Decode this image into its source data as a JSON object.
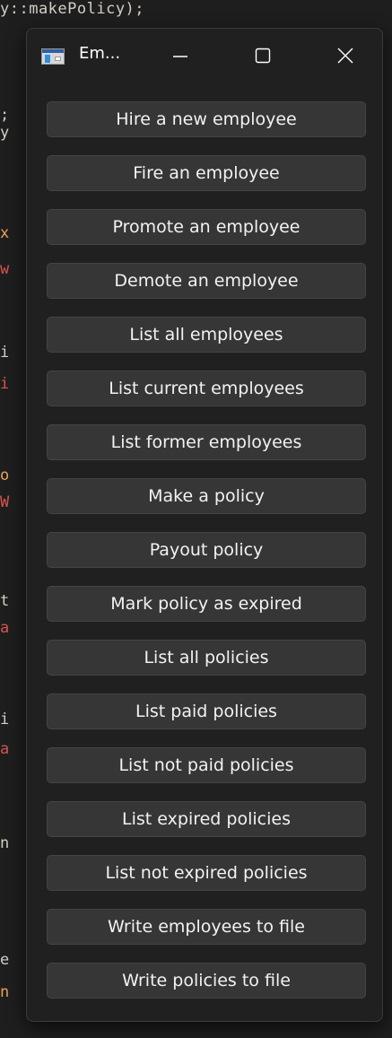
{
  "background_code": {
    "top_line": "y::makePolicy);",
    "fragments": [
      {
        "text": ";",
        "color": "#d4cfc4"
      },
      {
        "text": "y",
        "color": "#d4cfc4"
      },
      {
        "text": "x",
        "color": "#e8a35c"
      },
      {
        "text": "w",
        "color": "#d9534f"
      },
      {
        "text": "i",
        "color": "#d4cfc4"
      },
      {
        "text": "i",
        "color": "#d9534f"
      },
      {
        "text": "o",
        "color": "#e8a35c"
      },
      {
        "text": "W",
        "color": "#d9534f"
      },
      {
        "text": "t",
        "color": "#d4cfc4"
      },
      {
        "text": "a",
        "color": "#d9534f"
      },
      {
        "text": "i",
        "color": "#d4cfc4"
      },
      {
        "text": "a",
        "color": "#d9534f"
      },
      {
        "text": "n",
        "color": "#d4cfc4"
      },
      {
        "text": "e",
        "color": "#d4cfc4"
      },
      {
        "text": "n",
        "color": "#e8a35c"
      }
    ]
  },
  "window": {
    "title": "Em...",
    "controls": {
      "minimize_icon": "minimize-icon",
      "maximize_icon": "maximize-icon",
      "close_icon": "close-icon"
    },
    "buttons": [
      {
        "label": "Hire a new employee"
      },
      {
        "label": "Fire an employee"
      },
      {
        "label": "Promote an employee"
      },
      {
        "label": "Demote an employee"
      },
      {
        "label": "List all employees"
      },
      {
        "label": "List current employees"
      },
      {
        "label": "List former employees"
      },
      {
        "label": "Make a policy"
      },
      {
        "label": "Payout policy"
      },
      {
        "label": "Mark policy as expired"
      },
      {
        "label": "List all policies"
      },
      {
        "label": "List paid policies"
      },
      {
        "label": "List not paid policies"
      },
      {
        "label": "List expired policies"
      },
      {
        "label": "List not expired policies"
      },
      {
        "label": "Write employees to file"
      },
      {
        "label": "Write policies to file"
      }
    ]
  }
}
